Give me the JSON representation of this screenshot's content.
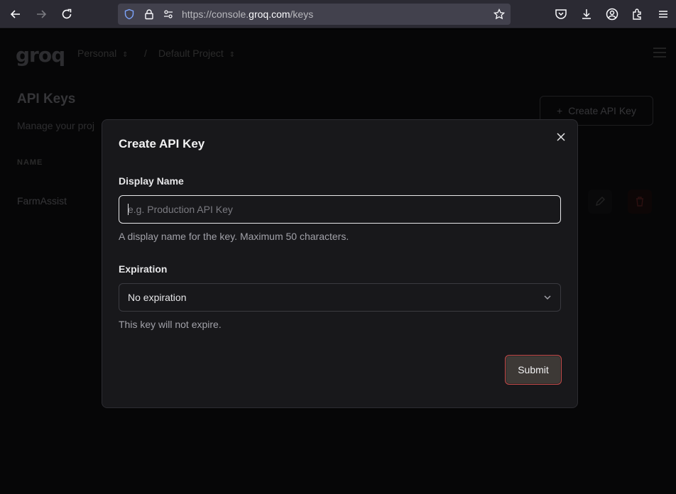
{
  "browser": {
    "url_prefix": "https://console.",
    "url_host": "groq.com",
    "url_path": "/keys"
  },
  "page": {
    "logo": "groq",
    "org": "Personal",
    "separator": "/",
    "project": "Default Project",
    "title": "API Keys",
    "subtitle": "Manage your proj",
    "create_button": "Create API Key",
    "column_name": "NAME",
    "rows": [
      {
        "name": "FarmAssist"
      }
    ]
  },
  "modal": {
    "title": "Create API Key",
    "display_name_label": "Display Name",
    "display_name_placeholder": "e.g. Production API Key",
    "display_name_value": "",
    "display_name_help": "A display name for the key. Maximum 50 characters.",
    "expiration_label": "Expiration",
    "expiration_value": "No expiration",
    "expiration_help": "This key will not expire.",
    "submit_label": "Submit"
  },
  "colors": {
    "modal_bg": "#18181b",
    "submit_border": "#c44a4a",
    "submit_bg": "#3d3936"
  }
}
